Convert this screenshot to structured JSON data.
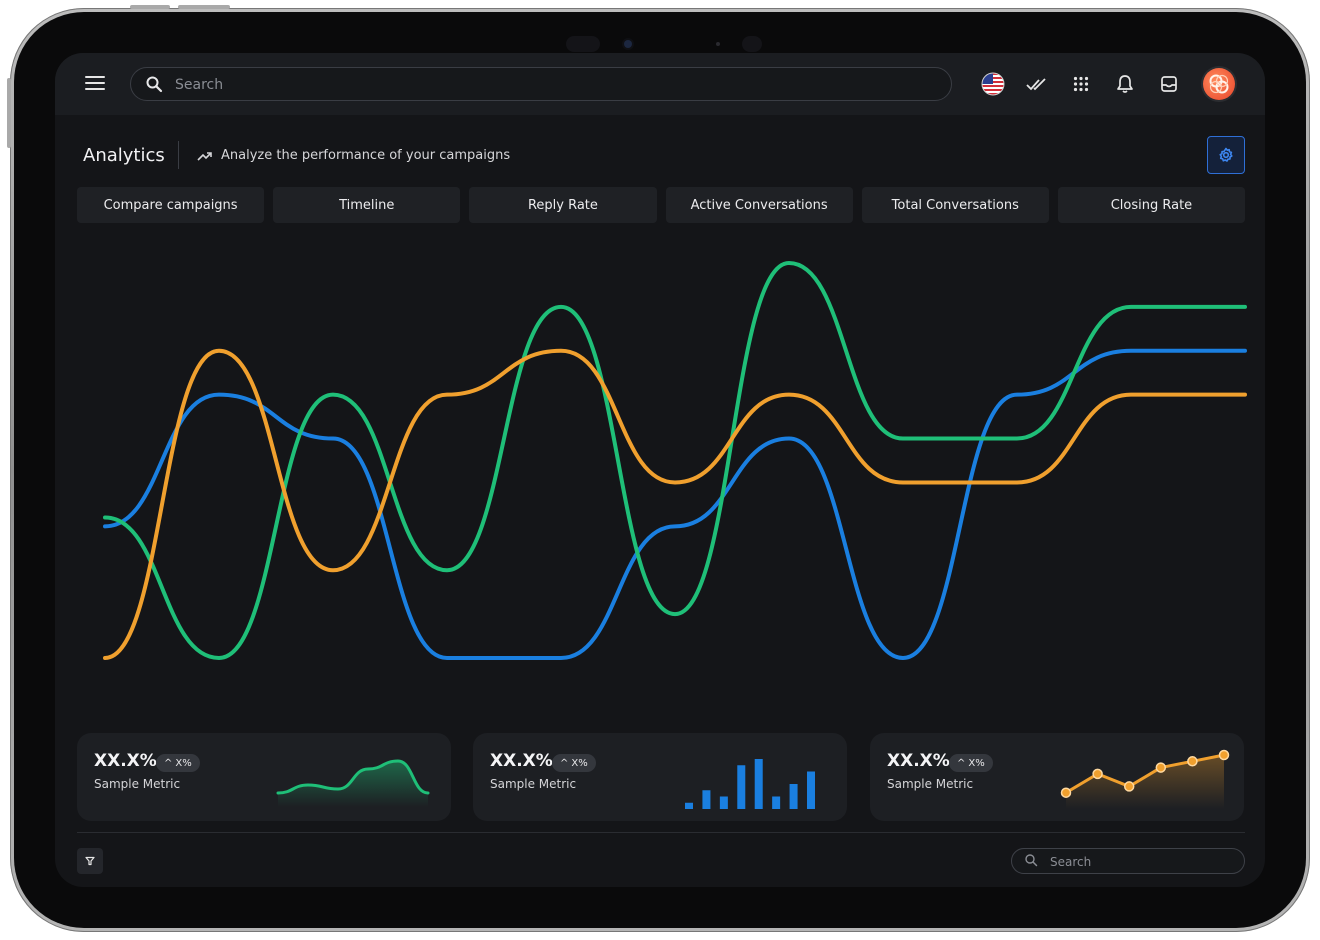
{
  "topbar": {
    "search_placeholder": "Search"
  },
  "header": {
    "title": "Analytics",
    "subtitle": "Analyze the performance of your campaigns"
  },
  "tabs": [
    {
      "label": "Compare campaigns"
    },
    {
      "label": "Timeline"
    },
    {
      "label": "Reply Rate"
    },
    {
      "label": "Active Conversations"
    },
    {
      "label": "Total Conversations"
    },
    {
      "label": "Closing Rate"
    }
  ],
  "colors": {
    "blue": "#1a7fe0",
    "green": "#1fbf78",
    "orange": "#f0a02e",
    "accent": "#2f6fd6"
  },
  "chart_data": {
    "type": "line",
    "x": [
      0,
      1,
      2,
      3,
      4,
      5,
      6,
      7,
      8,
      9,
      10
    ],
    "series": [
      {
        "color": "#1a7fe0",
        "values": [
          3,
          6,
          5,
          0,
          0,
          3,
          5,
          0,
          6,
          7,
          7
        ]
      },
      {
        "color": "#1fbf78",
        "values": [
          3.2,
          0,
          6,
          2,
          8,
          1,
          9,
          5,
          5,
          8,
          8
        ]
      },
      {
        "color": "#f0a02e",
        "values": [
          0,
          7,
          2,
          6,
          7,
          4,
          6,
          4,
          4,
          6,
          6
        ]
      }
    ],
    "ylim": [
      0,
      9
    ]
  },
  "cards": [
    {
      "value": "XX.X%",
      "delta": "X%",
      "label": "Sample Metric",
      "spark_type": "area",
      "spark_values": [
        1,
        2,
        1.5,
        4,
        5,
        1
      ]
    },
    {
      "value": "XX.X%",
      "delta": "X%",
      "label": "Sample Metric",
      "spark_type": "bar",
      "spark_values": [
        1,
        3,
        2,
        7,
        8,
        2,
        4,
        6
      ]
    },
    {
      "value": "XX.X%",
      "delta": "X%",
      "label": "Sample Metric",
      "spark_type": "line",
      "spark_values": [
        1,
        4,
        2,
        5,
        6,
        7
      ]
    }
  ],
  "footer": {
    "search_placeholder": "Search"
  }
}
